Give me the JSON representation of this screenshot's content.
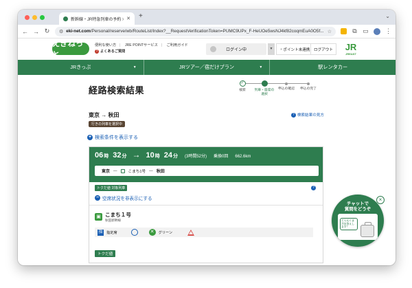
{
  "browser": {
    "tab_title": "新幹線・JR特急列車の予約 > 経路",
    "url_domain": "eki-net.com",
    "url_path": "/Personal/reserve/wb/RouteList/Index?__RequestVerificationToken=PUMC9UPx_F-HeUOe5wsNJ4kf82coqmEuA0O5f..."
  },
  "header": {
    "logo": "えきねっと",
    "links": [
      "便利な使い方",
      "JRE POINTサービス",
      "ご利用ガイド"
    ],
    "faq": "よくあるご質問",
    "login_status": "ログイン中",
    "points": "ポイント未連携",
    "logout": "ログアウト",
    "jr_logo": "JR",
    "jr_sub": "JREAST"
  },
  "nav": {
    "items": [
      "JRきっぷ",
      "JRツアー／宿だけプラン",
      "駅レンタカー"
    ]
  },
  "page": {
    "title": "経路検索結果",
    "steps": [
      {
        "label": "検索",
        "state": "done"
      },
      {
        "label": "列車・座席の選択",
        "state": "active"
      },
      {
        "label": "申込の確認",
        "state": "todo"
      },
      {
        "label": "申込の完了",
        "state": "todo"
      }
    ],
    "route_from": "東京",
    "route_arrow": "→",
    "route_to": "秋田",
    "selecting_badge": "行きの列車を選択中",
    "help_link": "検索結果の見方",
    "show_conditions": "検索条件を表示する"
  },
  "result": {
    "dep_h": "06",
    "dep_m": "32",
    "arr_h": "10",
    "arr_m": "24",
    "hour_unit": "時",
    "min_unit": "分",
    "arrow": "→",
    "duration": "(3時間52分)",
    "transfers": "乗換0回",
    "distance": "662.6km",
    "seg_from": "東京",
    "seg_train": "こまち1号",
    "seg_to": "秋田",
    "tokudane_tag": "トクだ値 対象列車",
    "hide_availability": "空席状況を非表示にする",
    "train_name": "こまち１号",
    "train_line": "秋田新幹線",
    "seat_reserved": "指定席",
    "seat_green": "グリーン",
    "tokudane_button": "トクだ値"
  },
  "chat": {
    "title_line1": "チャットで",
    "title_line2": "質問をどうぞ",
    "speech": "とらんくまがお答えします！"
  }
}
